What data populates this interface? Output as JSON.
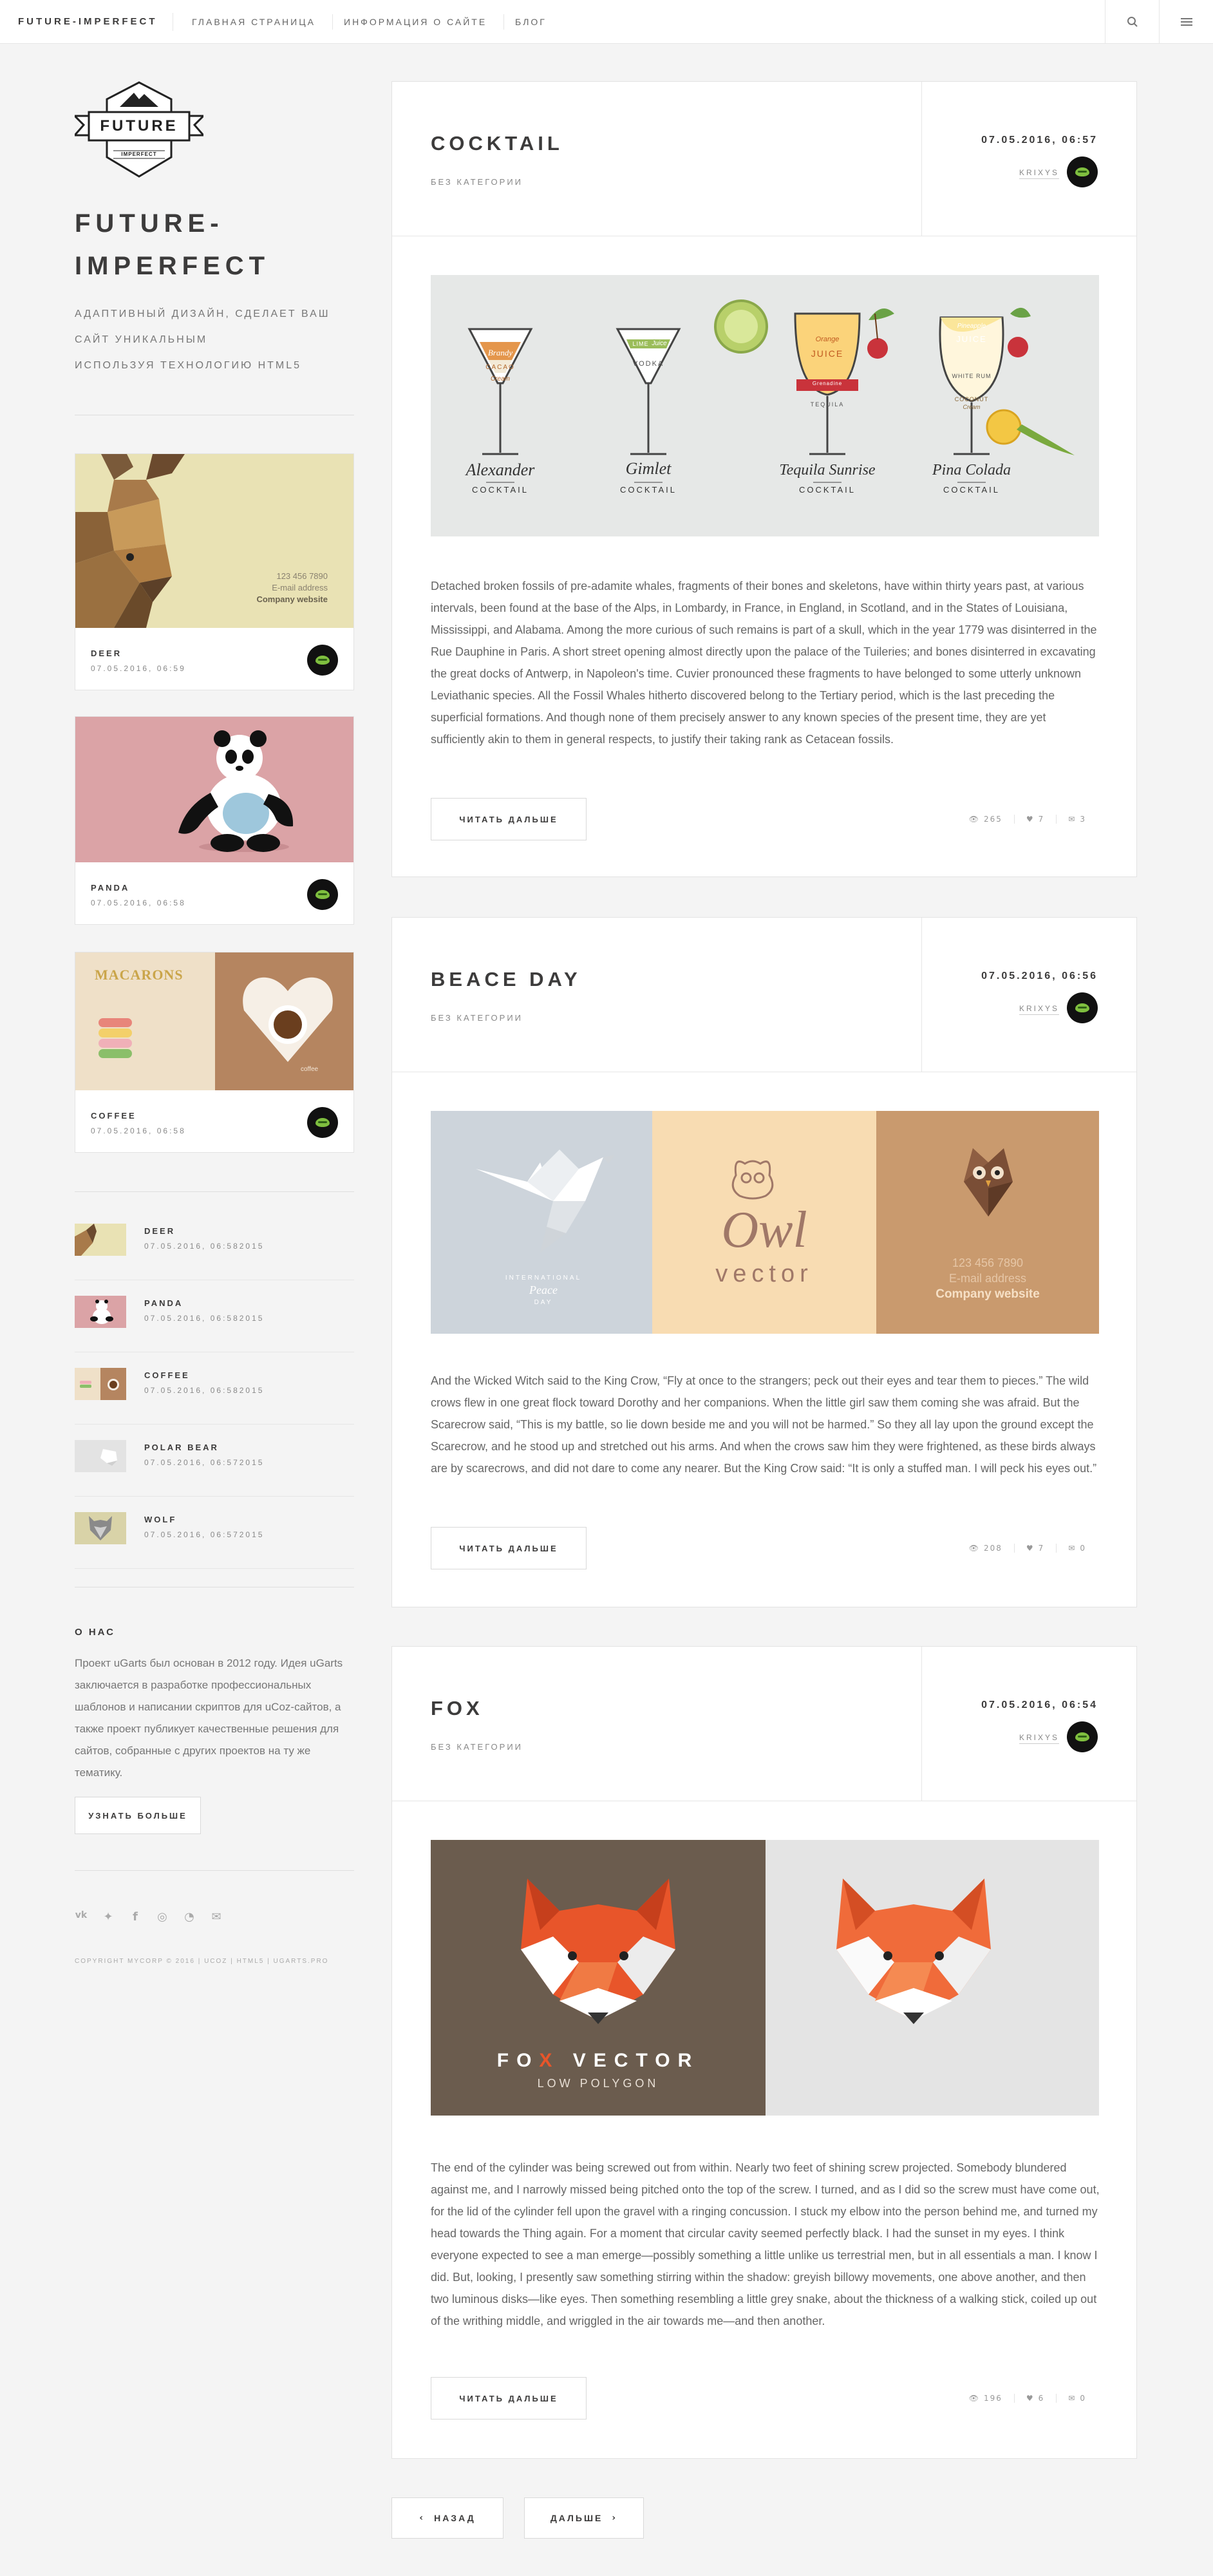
{
  "topbar": {
    "brand": "FUTURE-IMPERFECT",
    "nav": [
      "ГЛАВНАЯ СТРАНИЦА",
      "ИНФОРМАЦИЯ О САЙТЕ",
      "БЛОГ"
    ],
    "search_icon": "search-icon",
    "menu_icon": "menu-icon"
  },
  "sidebar": {
    "logo_text": "FUTURE",
    "logo_subtext": "IMPERFECT",
    "title_line1": "FUTURE-",
    "title_line2": "IMPERFECT",
    "tagline": [
      "АДАПТИВНЫЙ ДИЗАЙН, СДЕЛАЕТ ВАШ",
      "САЙТ УНИКАЛЬНЫМ",
      "ИСПОЛЬЗУЯ ТЕХНОЛОГИЮ HTML5"
    ],
    "mini_posts": [
      {
        "title": "DEER",
        "date": "07.05.2016, 06:59",
        "img_phone": "123 456 7890",
        "img_email": "E-mail address",
        "img_site": "Company website"
      },
      {
        "title": "PANDA",
        "date": "07.05.2016, 06:58"
      },
      {
        "title": "COFFEE",
        "date": "07.05.2016, 06:58",
        "img_word": "MACARONS",
        "img_word2": "coffee"
      }
    ],
    "recent_posts": [
      {
        "title": "DEER",
        "date": "07.05.2016, 06:582015"
      },
      {
        "title": "PANDA",
        "date": "07.05.2016, 06:582015"
      },
      {
        "title": "COFFEE",
        "date": "07.05.2016, 06:582015"
      },
      {
        "title": "POLAR BEAR",
        "date": "07.05.2016, 06:572015"
      },
      {
        "title": "WOLF",
        "date": "07.05.2016, 06:572015"
      }
    ],
    "about": {
      "heading": "О НАС",
      "text": "Проект uGarts был основан в 2012 году. Идея uGarts заключается в разработке профессиональных шаблонов и написании скриптов для uCoz-сайтов, а также проект публикует качественные решения для сайтов, собранные с других проектов на ту же тематику.",
      "button": "УЗНАТЬ БОЛЬШЕ"
    },
    "social_icons": [
      "vk-icon",
      "twitter-icon",
      "facebook-icon",
      "instagram-icon",
      "rss-icon",
      "mail-icon"
    ],
    "social_glyphs": [
      "vk",
      "✦",
      "f",
      "◎",
      "◔",
      "✉"
    ],
    "copyright": "COPYRIGHT MYCORP © 2016 | UCOZ | HTML5 | UGARTS.PRO"
  },
  "posts": [
    {
      "title": "COCKTAIL",
      "category": "БЕЗ КАТЕГОРИИ",
      "date": "07.05.2016, 06:57",
      "author": "KRIXYS",
      "cocktails": [
        {
          "name": "Alexander",
          "sub": "COCKTAIL",
          "l1": "Brandy",
          "l2": "CACAO",
          "l3": "Cream"
        },
        {
          "name": "Gimlet",
          "sub": "COCKTAIL",
          "l1": "LIME",
          "l2": "Juice",
          "l3": "VODKA"
        },
        {
          "name": "Tequila Sunrise",
          "sub": "COCKTAIL",
          "l1": "Orange",
          "l2": "JUICE",
          "l3": "TEQUILA",
          "l4": "Grenadine"
        },
        {
          "name": "Pina Colada",
          "sub": "COCKTAIL",
          "l1": "Pineapple",
          "l2": "JUICE",
          "l3": "WHITE RUM",
          "l4": "COCONUT",
          "l5": "Cream"
        }
      ],
      "text": "Detached broken fossils of pre-adamite whales, fragments of their bones and skeletons, have within thirty years past, at various intervals, been found at the base of the Alps, in Lombardy, in France, in England, in Scotland, and in the States of Louisiana, Mississippi, and Alabama. Among the more curious of such remains is part of a skull, which in the year 1779 was disinterred in the Rue Dauphine in Paris. A short street opening almost directly upon the palace of the Tuileries; and bones disinterred in excavating the great docks of Antwerp, in Napoleon's time. Cuvier pronounced these fragments to have belonged to some utterly unknown Leviathanic species. All the Fossil Whales hitherto discovered belong to the Tertiary period, which is the last preceding the superficial formations. And though none of them precisely answer to any known species of the present time, they are yet sufficiently akin to them in general respects, to justify their taking rank as Cetacean fossils.",
      "read_more": "ЧИТАТЬ ДАЛЬШЕ",
      "views": "265",
      "likes": "7",
      "comments": "3"
    },
    {
      "title": "BEACE DAY",
      "category": "БЕЗ КАТЕГОРИИ",
      "date": "07.05.2016, 06:56",
      "author": "KRIXYS",
      "img_peace_1": "INTERNATIONAL",
      "img_peace_2": "Peace",
      "img_peace_3": "DAY",
      "img_owl_word": "Owl",
      "img_owl_sub": "vector",
      "img_phone": "123 456 7890",
      "img_email": "E-mail address",
      "img_site": "Company website",
      "text": "And the Wicked Witch said to the King Crow, “Fly at once to the strangers; peck out their eyes and tear them to pieces.” The wild crows flew in one great flock toward Dorothy and her companions. When the little girl saw them coming she was afraid. But the Scarecrow said, “This is my battle, so lie down beside me and you will not be harmed.” So they all lay upon the ground except the Scarecrow, and he stood up and stretched out his arms. And when the crows saw him they were frightened, as these birds always are by scarecrows, and did not dare to come any nearer. But the King Crow said: “It is only a stuffed man. I will peck his eyes out.”",
      "read_more": "ЧИТАТЬ ДАЛЬШЕ",
      "views": "208",
      "likes": "7",
      "comments": "0"
    },
    {
      "title": "FOX",
      "category": "БЕЗ КАТЕГОРИИ",
      "date": "07.05.2016, 06:54",
      "author": "KRIXYS",
      "img_fo": "FO",
      "img_x": "X",
      "img_vector": "VECTOR",
      "img_low": "LOW POLYGON",
      "text": "The end of the cylinder was being screwed out from within. Nearly two feet of shining screw projected. Somebody blundered against me, and I narrowly missed being pitched onto the top of the screw. I turned, and as I did so the screw must have come out, for the lid of the cylinder fell upon the gravel with a ringing concussion. I stuck my elbow into the person behind me, and turned my head towards the Thing again. For a moment that circular cavity seemed perfectly black. I had the sunset in my eyes. I think everyone expected to see a man emerge—possibly something a little unlike us terrestrial men, but in all essentials a man. I know I did. But, looking, I presently saw something stirring within the shadow: greyish billowy movements, one above another, and then two luminous disks—like eyes. Then something resembling a little grey snake, about the thickness of a walking stick, coiled up out of the writhing middle, and wriggled in the air towards me—and then another.",
      "read_more": "ЧИТАТЬ ДАЛЬШЕ",
      "views": "196",
      "likes": "6",
      "comments": "0"
    }
  ],
  "pagination": {
    "prev": "НАЗАД",
    "next": "ДАЛЬШЕ"
  },
  "colors": {
    "accent": "#3c3b3b",
    "background": "#f4f4f4",
    "fox_orange": "#e8552a",
    "deer_bg": "#e9e2b4",
    "panda_bg": "#dba3a6"
  }
}
